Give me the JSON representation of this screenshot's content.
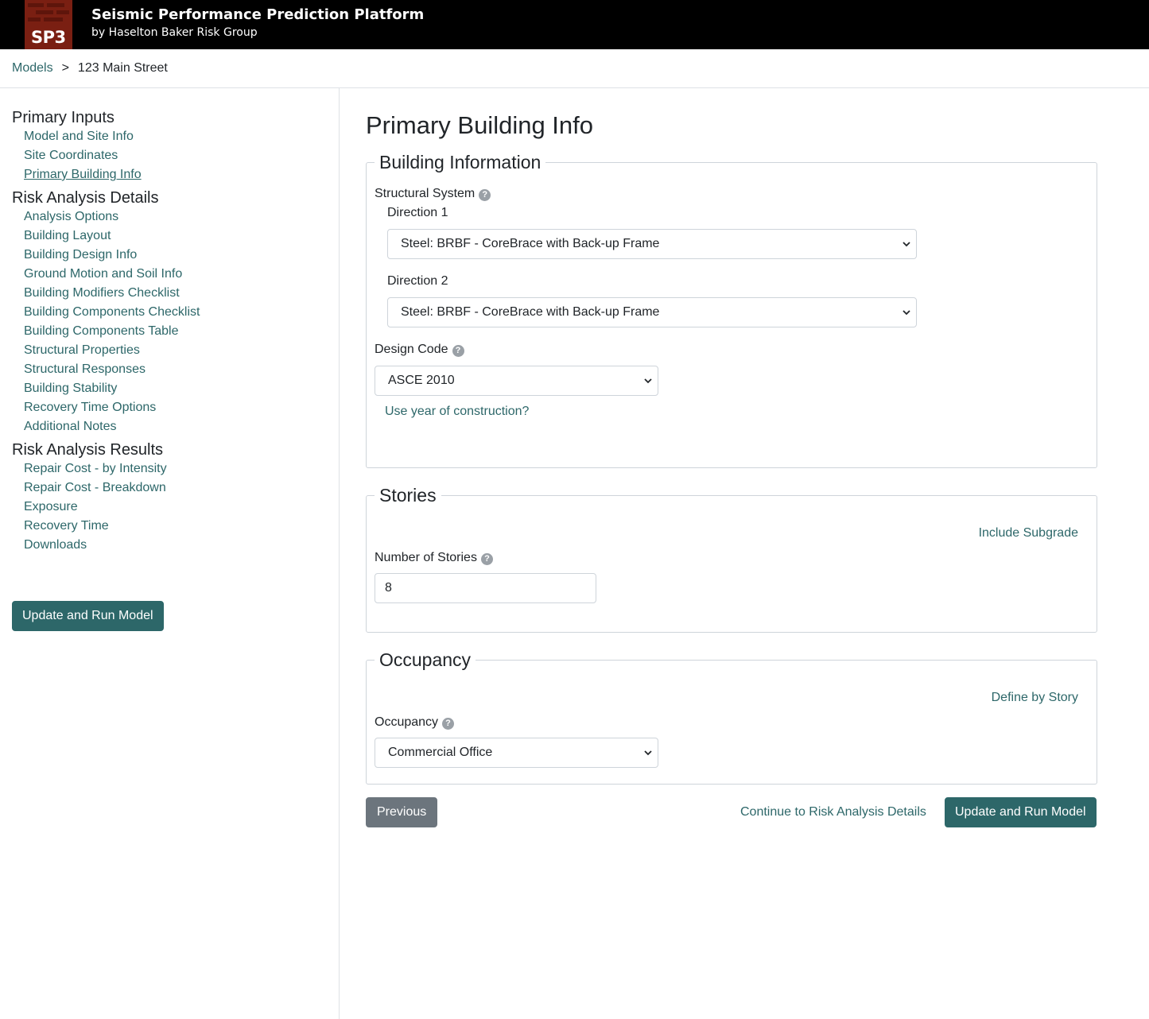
{
  "header": {
    "logo_text": "SP3",
    "title": "Seismic Performance Prediction Platform",
    "subtitle": "by Haselton Baker Risk Group"
  },
  "breadcrumb": {
    "root": "Models",
    "separator": ">",
    "current": "123 Main Street"
  },
  "sidebar": {
    "sections": [
      {
        "heading": "Primary Inputs",
        "items": [
          "Model and Site Info",
          "Site Coordinates",
          "Primary Building Info"
        ]
      },
      {
        "heading": "Risk Analysis Details",
        "items": [
          "Analysis Options",
          "Building Layout",
          "Building Design Info",
          "Ground Motion and Soil Info",
          "Building Modifiers Checklist",
          "Building Components Checklist",
          "Building Components Table",
          "Structural Properties",
          "Structural Responses",
          "Building Stability",
          "Recovery Time Options",
          "Additional Notes"
        ]
      },
      {
        "heading": "Risk Analysis Results",
        "items": [
          "Repair Cost - by Intensity",
          "Repair Cost - Breakdown",
          "Exposure",
          "Recovery Time",
          "Downloads"
        ]
      }
    ],
    "active_item": "Primary Building Info",
    "run_button": "Update and Run Model"
  },
  "main": {
    "title": "Primary Building Info",
    "building_info": {
      "legend": "Building Information",
      "structural_system_label": "Structural System",
      "direction1_label": "Direction 1",
      "direction1_value": "Steel: BRBF - CoreBrace with Back-up Frame",
      "direction2_label": "Direction 2",
      "direction2_value": "Steel: BRBF - CoreBrace with Back-up Frame",
      "design_code_label": "Design Code",
      "design_code_value": "ASCE 2010",
      "year_link": "Use year of construction?"
    },
    "stories": {
      "legend": "Stories",
      "subgrade_link": "Include Subgrade",
      "num_label": "Number of Stories",
      "num_value": "8"
    },
    "occupancy": {
      "legend": "Occupancy",
      "define_link": "Define by Story",
      "label": "Occupancy",
      "value": "Commercial Office"
    },
    "footer": {
      "previous": "Previous",
      "continue": "Continue to Risk Analysis Details",
      "run": "Update and Run Model"
    }
  },
  "colors": {
    "accent": "#2d6769",
    "header_bg": "#000000",
    "logo_bg": "#7a1f12",
    "secondary_button": "#6c757d"
  }
}
